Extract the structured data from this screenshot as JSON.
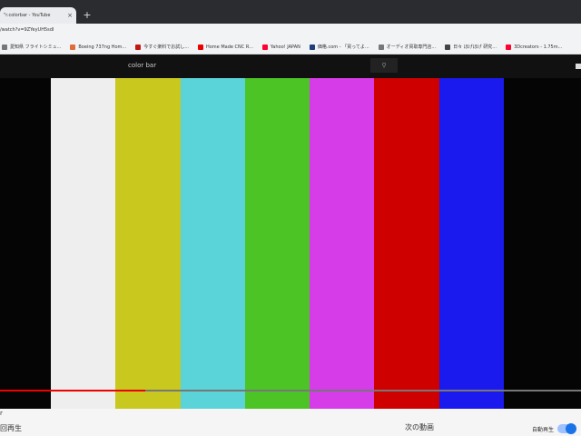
{
  "browser": {
    "tab_title": "\"r.colorbar - YouTube",
    "tab_close": "×",
    "new_tab": "+",
    "url": "/watch?v=9ZYeyUH5sdI"
  },
  "bookmarks": [
    {
      "label": "愛知県 フライトシミュ...",
      "color": "#777"
    },
    {
      "label": "Boeing 737ng Hom...",
      "color": "#e26b3a"
    },
    {
      "label": "今すぐ楽料でお試し...",
      "color": "#c51616"
    },
    {
      "label": "Home Made CNC R...",
      "color": "#e00"
    },
    {
      "label": "Yahoo! JAPAN",
      "color": "#f03"
    },
    {
      "label": "価格.com - 「買ってよ...",
      "color": "#1f3f7a"
    },
    {
      "label": "オーディオ買取専門店...",
      "color": "#777"
    },
    {
      "label": "日々 ほげほげ 研究...",
      "color": "#444"
    },
    {
      "label": "3Dcreators - 1.75m...",
      "color": "#f03"
    }
  ],
  "youtube": {
    "search_text": "color bar",
    "search_icon": "search-icon"
  },
  "video": {
    "bars": [
      "#eeeeee",
      "#c9c81f",
      "#5ad4d8",
      "#4cc425",
      "#d63de8",
      "#cf0000",
      "#1a1aee"
    ],
    "progress_fraction": 0.25
  },
  "bottom": {
    "left_label": "回再生",
    "center_label": "次の動画",
    "autoplay_label": "自動再生",
    "edge_char": "r"
  }
}
